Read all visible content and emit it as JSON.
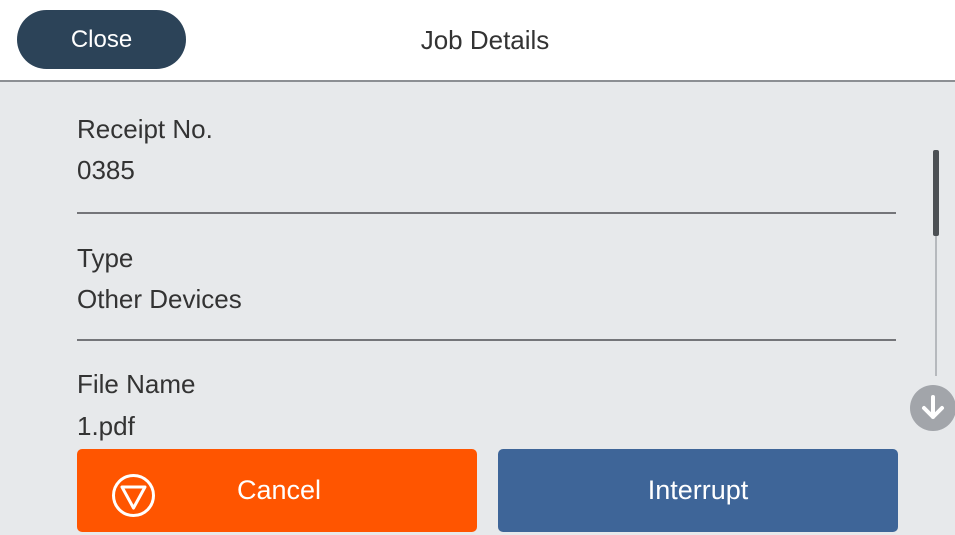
{
  "header": {
    "close_label": "Close",
    "title": "Job Details"
  },
  "details": [
    {
      "label": "Receipt No.",
      "value": "0385"
    },
    {
      "label": "Type",
      "value": "Other Devices"
    },
    {
      "label": "File Name",
      "value": "1.pdf"
    }
  ],
  "actions": {
    "cancel_label": "Cancel",
    "interrupt_label": "Interrupt"
  },
  "icons": {
    "cancel": "stop-icon",
    "scroll": "arrow-down-icon"
  },
  "colors": {
    "header_button": "#2c4358",
    "cancel": "#ff5500",
    "interrupt": "#3e6598",
    "background": "#e7e9eb"
  }
}
